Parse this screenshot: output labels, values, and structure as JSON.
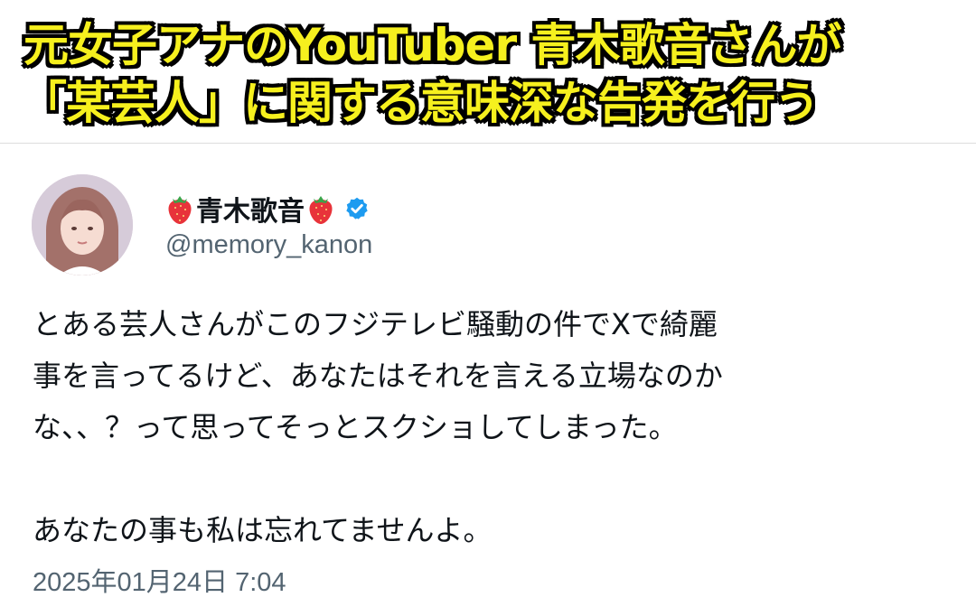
{
  "headline": {
    "line1": "元女子アナのYouTuber 青木歌音さんが",
    "line2": "「某芸人」に関する意味深な告発を行う",
    "text_color": "#f6f01e",
    "outline_color": "#000000"
  },
  "tweet": {
    "author": {
      "display_name": "青木歌音",
      "emoji_prefix": "strawberry-icon",
      "emoji_suffix": "strawberry-icon",
      "verified": true,
      "handle": "@memory_kanon"
    },
    "body": {
      "paragraph1": [
        "とある芸人さんがこのフジテレビ騒動の件でXで綺麗",
        "事を言ってるけど、あなたはそれを言える立場なのか",
        "な、、？って思ってそっとスクショしてしまった。"
      ],
      "paragraph2": [
        "あなたの事も私は忘れてませんよ。"
      ]
    },
    "timestamp": "2025年01月24日 7:04"
  },
  "colors": {
    "verified_blue": "#1d9bf0",
    "text_primary": "#0f1419",
    "text_secondary": "#536471",
    "strawberry_red": "#e8333a"
  }
}
